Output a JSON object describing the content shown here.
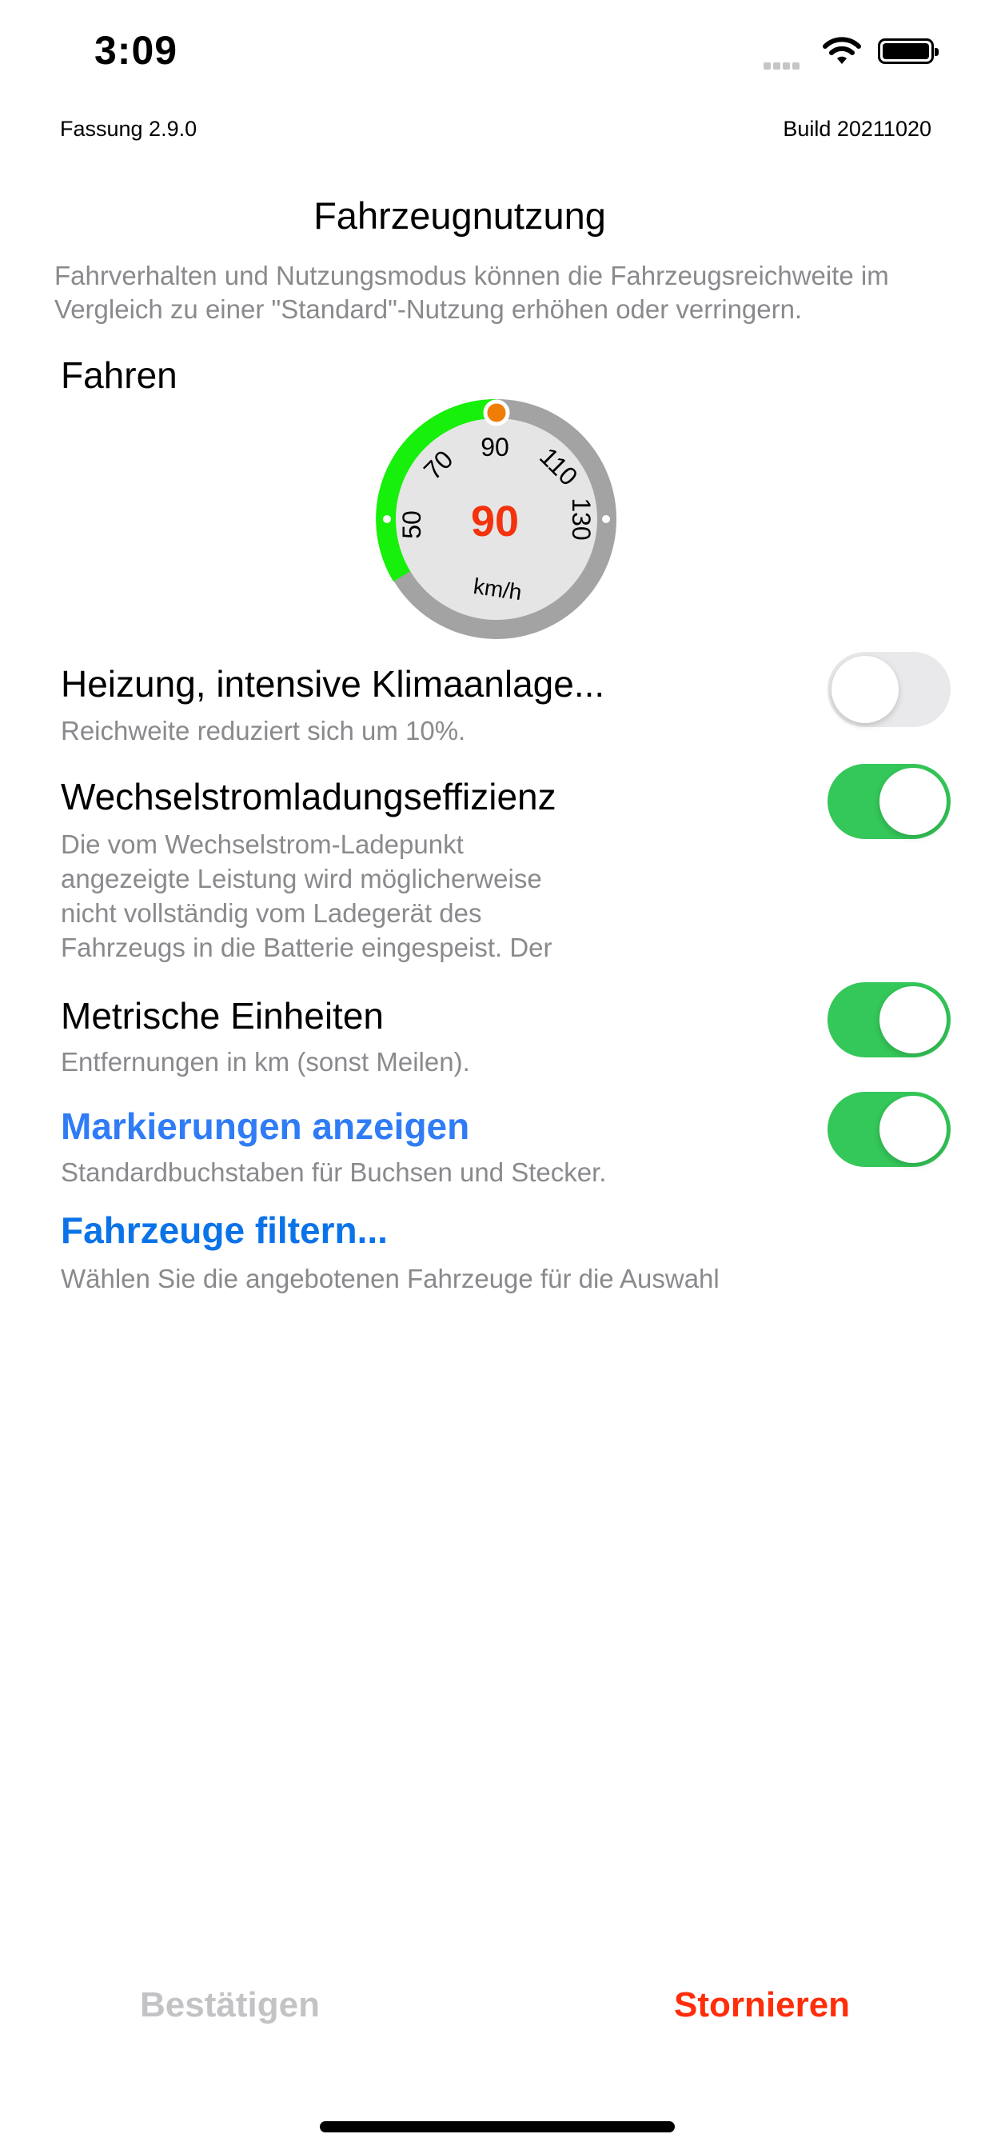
{
  "status": {
    "time": "3:09"
  },
  "header": {
    "version": "Fassung 2.9.0",
    "build": "Build 20211020"
  },
  "title": "Fahrzeugnutzung",
  "intro": "Fahrverhalten und Nutzungsmodus können die Fahrzeugsreichweite im Vergleich zu einer \"Standard\"-Nutzung erhöhen oder verringern.",
  "driving": {
    "label": "Fahren",
    "speed_value": "90",
    "unit": "km/h",
    "ticks": [
      "50",
      "70",
      "90",
      "110",
      "130"
    ],
    "selected_speed": 90,
    "range": [
      50,
      130
    ],
    "accent_color": "#16f00a",
    "value_color": "#f2330d",
    "handle_color": "#f07d05"
  },
  "settings": [
    {
      "title": "Heizung, intensive Klimaanlage...",
      "subtitle": "Reichweite reduziert sich um 10%.",
      "enabled": false
    },
    {
      "title": "Wechselstromladungseffizienz",
      "subtitle_lines": [
        "Die vom Wechselstrom-Ladepunkt",
        "angezeigte Leistung wird möglicherweise",
        "nicht vollständig vom Ladegerät des",
        "Fahrzeugs in die Batterie eingespeist. Der"
      ],
      "enabled": true
    },
    {
      "title": "Metrische Einheiten",
      "subtitle": "Entfernungen in km (sonst Meilen).",
      "enabled": true
    },
    {
      "title": "Markierungen anzeigen",
      "subtitle": "Standardbuchstaben für Buchsen und Stecker.",
      "enabled": true
    }
  ],
  "filter": {
    "title": "Fahrzeuge filtern...",
    "subtitle": "Wählen Sie die angebotenen Fahrzeuge für die Auswahl"
  },
  "footer": {
    "confirm": "Bestätigen",
    "cancel": "Stornieren"
  },
  "colors": {
    "toggle_on": "#34c759",
    "link": "#2f7cf6",
    "cancel": "#ff2d0a"
  }
}
